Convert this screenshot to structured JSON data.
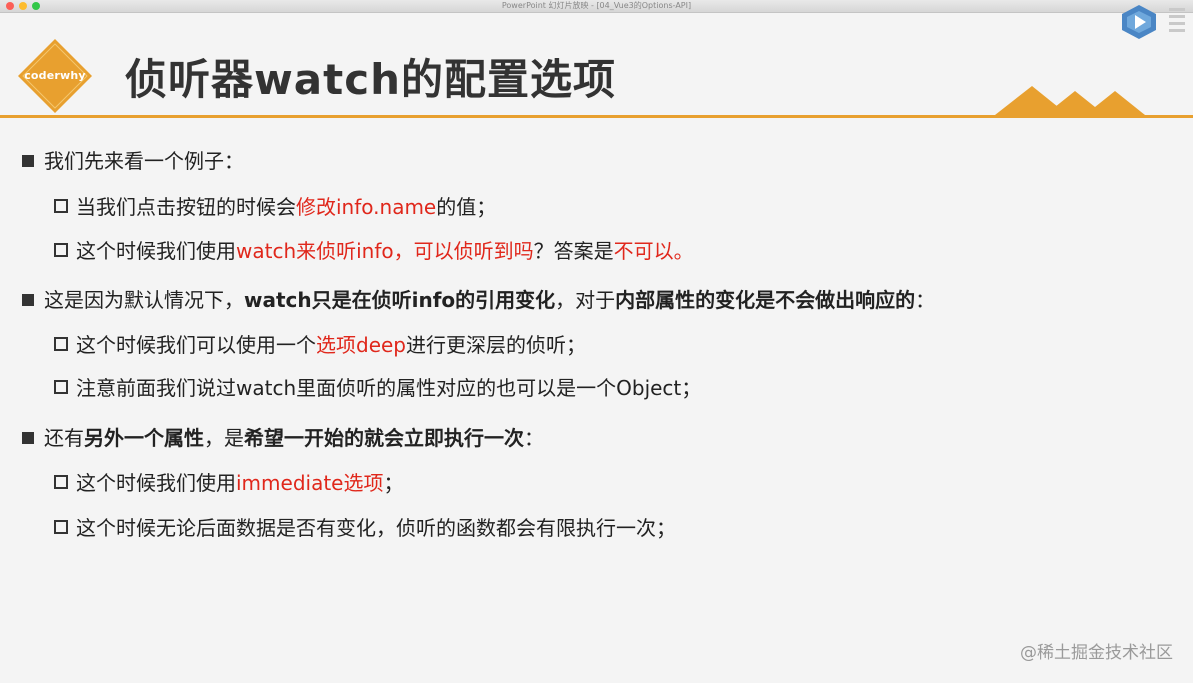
{
  "window": {
    "title": "PowerPoint 幻灯片放映 - [04_Vue3的Options-API]"
  },
  "logo": {
    "text": "coderwhy"
  },
  "slide": {
    "title": "侦听器watch的配置选项",
    "bullets": [
      {
        "level": 1,
        "segments": [
          {
            "text": "我们先来看一个例子：",
            "style": "normal"
          }
        ]
      },
      {
        "level": 2,
        "segments": [
          {
            "text": "当我们点击按钮的时候会",
            "style": "normal"
          },
          {
            "text": "修改",
            "style": "red"
          },
          {
            "text": "info.name",
            "style": "red"
          },
          {
            "text": "的值；",
            "style": "normal"
          }
        ]
      },
      {
        "level": 2,
        "segments": [
          {
            "text": "这个时候我们使用",
            "style": "normal"
          },
          {
            "text": "watch来侦听info，可以侦听到吗",
            "style": "red"
          },
          {
            "text": "？答案是",
            "style": "normal"
          },
          {
            "text": "不可以。",
            "style": "red"
          }
        ]
      },
      {
        "level": 1,
        "segments": [
          {
            "text": "这是因为默认情况下，",
            "style": "normal"
          },
          {
            "text": "watch只是在侦听info的引用变化",
            "style": "bold"
          },
          {
            "text": "，对于",
            "style": "normal"
          },
          {
            "text": "内部属性的变化是不会做出响应的",
            "style": "bold"
          },
          {
            "text": "：",
            "style": "normal"
          }
        ]
      },
      {
        "level": 2,
        "segments": [
          {
            "text": "这个时候我们可以使用一个",
            "style": "normal"
          },
          {
            "text": "选项deep",
            "style": "red"
          },
          {
            "text": "进行更深层的侦听；",
            "style": "normal"
          }
        ]
      },
      {
        "level": 2,
        "segments": [
          {
            "text": "注意前面我们说过watch里面侦听的属性对应的也可以是一个Object；",
            "style": "normal"
          }
        ]
      },
      {
        "level": 1,
        "segments": [
          {
            "text": "还有",
            "style": "normal"
          },
          {
            "text": "另外一个属性",
            "style": "bold"
          },
          {
            "text": "，是",
            "style": "normal"
          },
          {
            "text": "希望一开始的就会立即执行一次",
            "style": "bold"
          },
          {
            "text": "：",
            "style": "normal"
          }
        ]
      },
      {
        "level": 2,
        "segments": [
          {
            "text": "这个时候我们使用",
            "style": "normal"
          },
          {
            "text": "immediate选项",
            "style": "red"
          },
          {
            "text": "；",
            "style": "normal"
          }
        ]
      },
      {
        "level": 2,
        "segments": [
          {
            "text": "这个时候无论后面数据是否有变化，侦听的函数都会有限执行一次；",
            "style": "normal"
          }
        ]
      }
    ]
  },
  "watermark": "@稀土掘金技术社区",
  "colors": {
    "accent": "#e8a02f",
    "highlight_red": "#e0271b",
    "text": "#222222"
  }
}
